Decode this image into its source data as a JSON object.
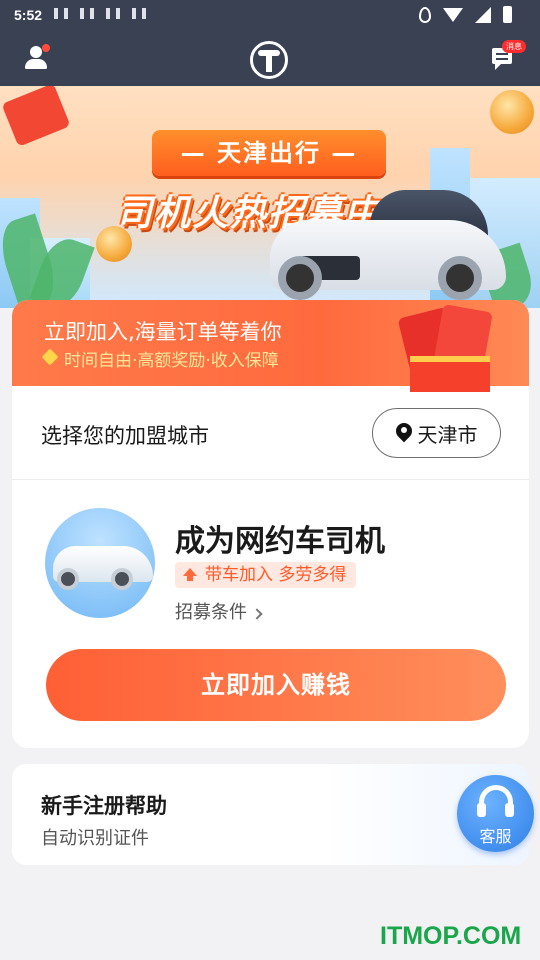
{
  "status_bar": {
    "time": "5:52"
  },
  "nav": {
    "message_badge": "消息"
  },
  "banner": {
    "tagline": "— 天津出行 —",
    "headline": "司机火热招募中"
  },
  "promo": {
    "title": "立即加入,海量订单等着你",
    "subtitle": "时间自由·高额奖励·收入保障"
  },
  "city": {
    "label": "选择您的加盟城市",
    "selected": "天津市"
  },
  "driver": {
    "title": "成为网约车司机",
    "tag": "带车加入 多劳多得",
    "conditions_link": "招募条件"
  },
  "join_button": "立即加入赚钱",
  "help": {
    "title": "新手注册帮助",
    "subtitle": "自动识别证件"
  },
  "service": {
    "label": "客服"
  },
  "watermark": "ITMOP.COM",
  "colors": {
    "accent": "#ff6a3d",
    "nav_bg": "#3a4152",
    "service_blue": "#2f7fe6"
  }
}
